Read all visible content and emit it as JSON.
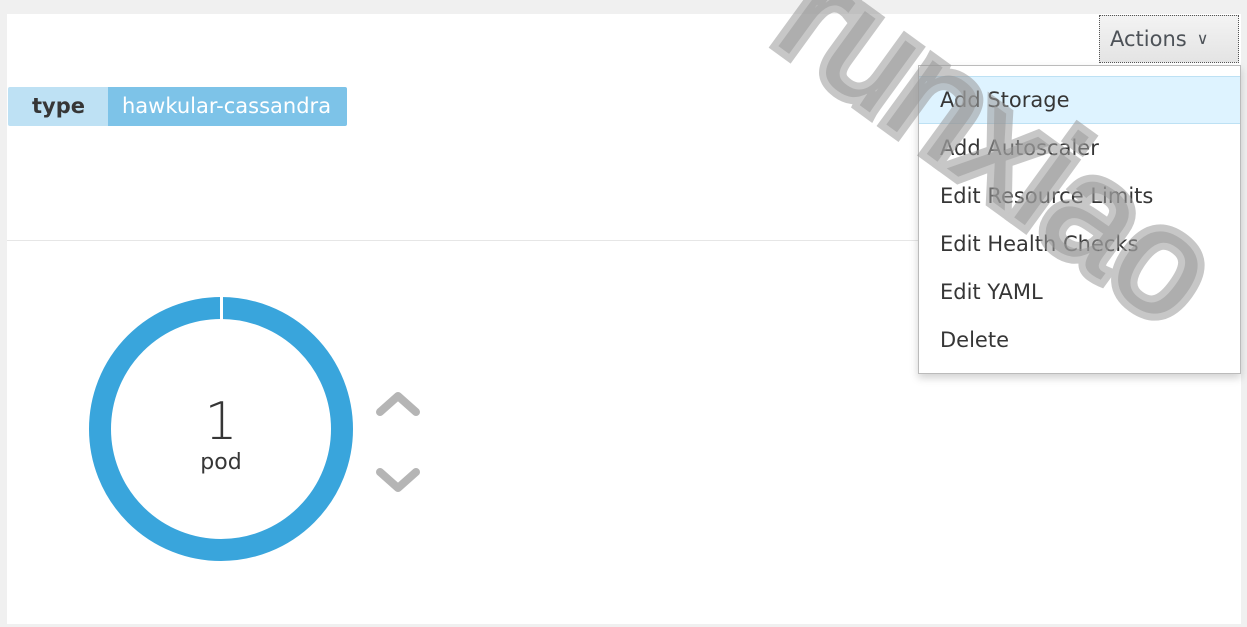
{
  "labels": {
    "key": "type",
    "value": "hawkular-cassandra"
  },
  "actions": {
    "button_label": "Actions",
    "menu_items": [
      "Add Storage",
      "Add Autoscaler",
      "Edit Resource Limits",
      "Edit Health Checks",
      "Edit YAML",
      "Delete"
    ]
  },
  "pods": {
    "count": "1",
    "label": "pod"
  },
  "watermark": "runxiao",
  "colors": {
    "donut": "#39a5dc",
    "chip_key_bg": "#bee1f4",
    "chip_value_bg": "#7dc3e8",
    "menu_active_bg": "#def3ff"
  }
}
